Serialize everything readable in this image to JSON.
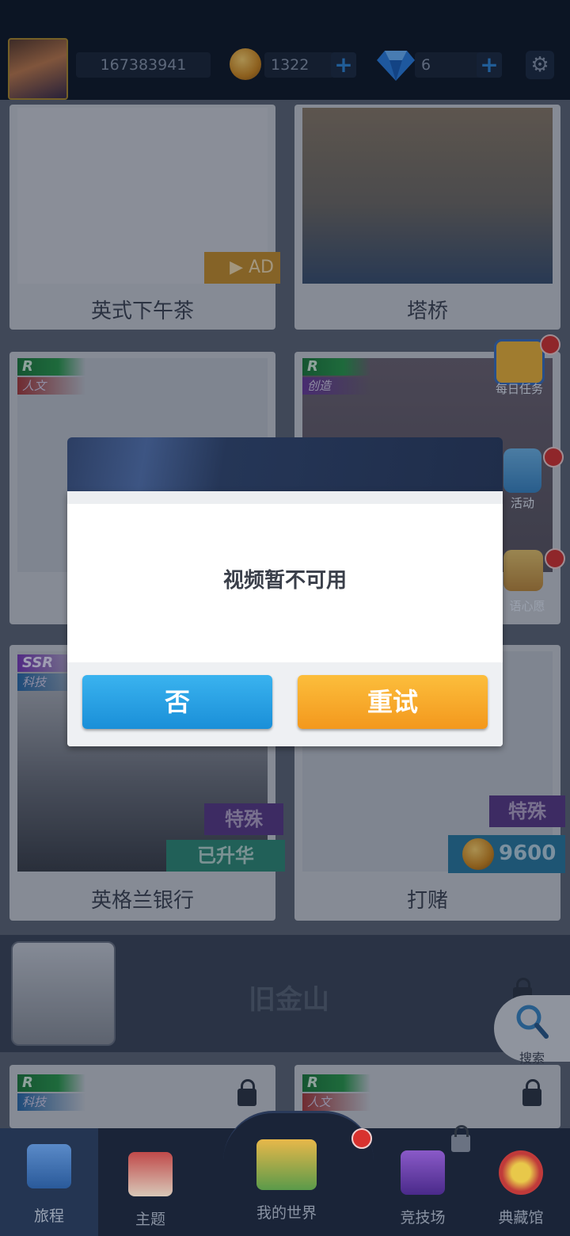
{
  "topbar": {
    "player_id": "167383941",
    "coins": "1322",
    "gems": "6",
    "plus_label": "+",
    "settings_icon": "gear-icon"
  },
  "cards": [
    {
      "title": "英式下午茶",
      "ad_label": "AD"
    },
    {
      "title": "塔桥"
    },
    {
      "tag": "R",
      "category": "人文"
    },
    {
      "tag": "R",
      "category": "创造"
    },
    {
      "title": "英格兰银行",
      "tag": "SSR",
      "category": "科技",
      "badge": "特殊",
      "status": "已升华"
    },
    {
      "title": "打赌",
      "badge": "特殊",
      "price": "9600"
    }
  ],
  "city_section": {
    "title": "旧金山"
  },
  "bottom_cards": [
    {
      "tag": "R",
      "category": "科技"
    },
    {
      "tag": "R",
      "category": "人文"
    }
  ],
  "side_menu": {
    "daily": "每日任务",
    "event": "活动",
    "mood": "语心愿",
    "search": "搜索"
  },
  "dialog": {
    "message": "视频暂不可用",
    "no_label": "否",
    "retry_label": "重试"
  },
  "nav": {
    "items": [
      "旅程",
      "主题",
      "我的世界",
      "竞技场",
      "典藏馆"
    ],
    "active": "旅程"
  },
  "colors": {
    "btn_no": "#1a8fd8",
    "btn_retry": "#f3981d",
    "header": "#0e1726"
  }
}
